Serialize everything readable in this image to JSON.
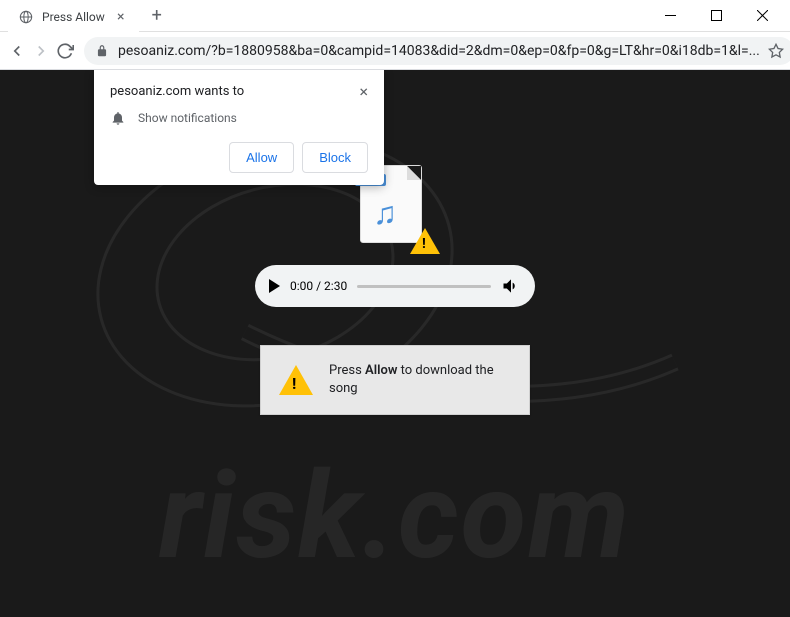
{
  "window": {
    "tab_title": "Press Allow",
    "url": "pesoaniz.com/?b=1880958&ba=0&campid=14083&did=2&dm=0&ep=0&fp=0&g=LT&hr=0&i18db=1&l=..."
  },
  "permission_prompt": {
    "site_wants_to": "pesoaniz.com wants to",
    "permission_label": "Show notifications",
    "allow_label": "Allow",
    "block_label": "Block"
  },
  "audio_file": {
    "badge": "AUDIO"
  },
  "player": {
    "current_time": "0:00",
    "separator": " / ",
    "total_time": "2:30"
  },
  "message": {
    "prefix": "Press ",
    "bold": "Allow",
    "suffix": " to download the song"
  },
  "watermark": {
    "text": "risk.com"
  }
}
